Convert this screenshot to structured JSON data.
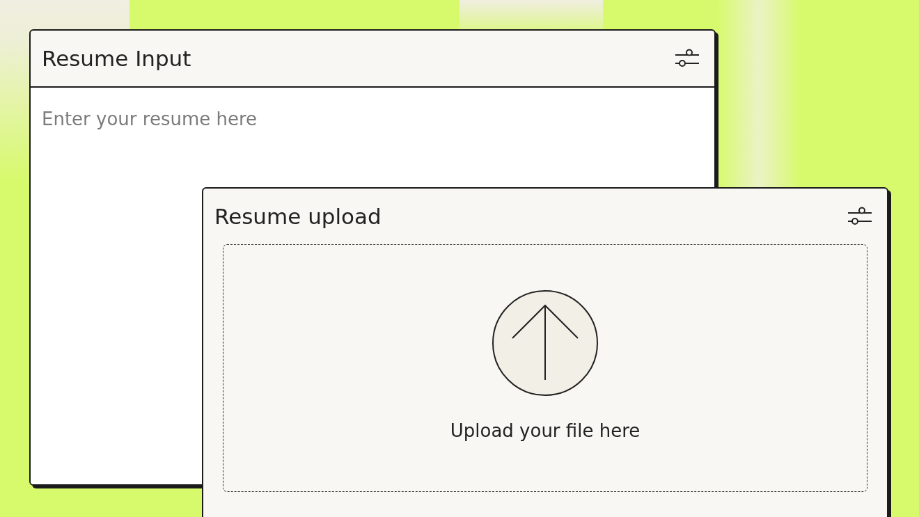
{
  "windows": [
    {
      "kind": "text",
      "title": "Resume Input",
      "placeholder": "Enter your resume here"
    },
    {
      "kind": "upload",
      "title": "Resume upload",
      "prompt": "Upload your file here"
    }
  ]
}
